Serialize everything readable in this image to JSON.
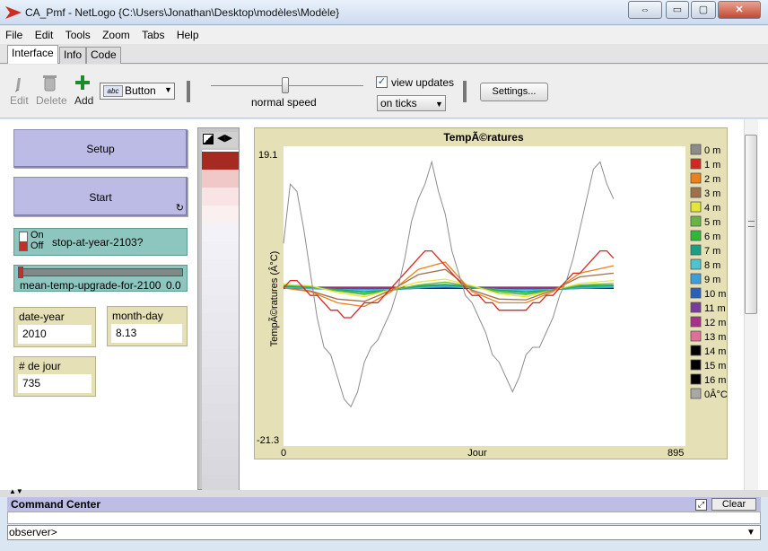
{
  "window": {
    "title": "CA_Pmf - NetLogo {C:\\Users\\Jonathan\\Desktop\\modèles\\Modèle}",
    "controls": {
      "restore": "⇔",
      "minimize": "▭",
      "maximize": "▢",
      "close": "✕"
    }
  },
  "menu": [
    "File",
    "Edit",
    "Tools",
    "Zoom",
    "Tabs",
    "Help"
  ],
  "tabs": [
    {
      "label": "Interface",
      "active": true
    },
    {
      "label": "Info",
      "active": false
    },
    {
      "label": "Code",
      "active": false
    }
  ],
  "toolbar": {
    "edit_label": "Edit",
    "delete_label": "Delete",
    "add_label": "Add",
    "widget_type": "Button",
    "widget_icon_text": "abc",
    "speed_label": "normal speed",
    "view_updates_label": "view updates",
    "view_updates_checked": true,
    "update_mode": "on ticks",
    "settings_label": "Settings..."
  },
  "widgets": {
    "setup_label": "Setup",
    "start_label": "Start",
    "switch": {
      "on_label": "On",
      "off_label": "Off",
      "label": "stop-at-year-2103?"
    },
    "slider": {
      "label": "mean-temp-upgrade-for-2100",
      "value": "0.0"
    },
    "monitors": [
      {
        "label": "date-year",
        "value": "2010"
      },
      {
        "label": "month-day",
        "value": "8.13"
      },
      {
        "label": "# de jour",
        "value": "735"
      }
    ]
  },
  "world": {
    "patch_colors": [
      "#ffffff",
      "#a52a22",
      "#f0c8c8",
      "#f8e4e4",
      "#fbf0f0",
      "#f2f2f8",
      "#f0f0f6",
      "#eeeef4",
      "#ececf2",
      "#eaeaf0",
      "#e8e8ee",
      "#e6e6ec",
      "#e4e4ea",
      "#e2e2e8",
      "#e0e0e6",
      "#dedee4",
      "#dcdce2",
      "#dadae0",
      "#d8d8de",
      "#d6d6dc",
      "#d4d4da"
    ]
  },
  "plot": {
    "title": "TempÃ©ratures",
    "ylabel": "TempÃ©ratures (Â°C)",
    "xlabel": "Jour",
    "ymax_label": "19.1",
    "ymin_label": "-21.3",
    "xmin_label": "0",
    "xmax_label": "895"
  },
  "chart_data": {
    "type": "line",
    "title": "TempÃ©ratures",
    "xlabel": "Jour",
    "ylabel": "TempÃ©ratures (Â°C)",
    "xlim": [
      0,
      895
    ],
    "ylim": [
      -21.3,
      19.1
    ],
    "legend_position": "right",
    "grid": false,
    "series": [
      {
        "name": "0 m",
        "color": "#8c8c8c",
        "x": [
          0,
          15,
          30,
          45,
          60,
          75,
          90,
          105,
          120,
          135,
          150,
          165,
          180,
          195,
          210,
          225,
          240,
          255,
          270,
          285,
          300,
          315,
          330,
          345,
          360,
          375,
          390,
          405,
          420,
          435,
          450,
          465,
          480,
          495,
          510,
          525,
          540,
          555,
          570,
          585,
          600,
          615,
          630,
          645,
          660,
          675,
          690,
          705,
          720,
          735
        ],
        "y": [
          6,
          14,
          13,
          8,
          2,
          -4,
          -8,
          -9,
          -12,
          -15,
          -16,
          -14,
          -10,
          -8,
          -7,
          -5,
          -3,
          0,
          4,
          9,
          12,
          14,
          17,
          13,
          10,
          5,
          2,
          -1,
          -2,
          -4,
          -6,
          -9,
          -10,
          -12,
          -14,
          -12,
          -9,
          -8,
          -8,
          -6,
          -4,
          -1,
          1,
          4,
          8,
          12,
          16,
          17,
          14,
          12
        ]
      },
      {
        "name": "1 m",
        "color": "#d7261e",
        "x": [
          0,
          15,
          30,
          45,
          60,
          75,
          90,
          105,
          120,
          135,
          150,
          165,
          180,
          195,
          210,
          225,
          240,
          255,
          270,
          285,
          300,
          315,
          330,
          345,
          360,
          375,
          390,
          405,
          420,
          435,
          450,
          465,
          480,
          495,
          510,
          525,
          540,
          555,
          570,
          585,
          600,
          615,
          630,
          645,
          660,
          675,
          690,
          705,
          720,
          735
        ],
        "y": [
          0,
          1,
          1,
          0,
          -1,
          -1,
          -2,
          -3,
          -3,
          -4,
          -4,
          -3,
          -2,
          -2,
          -2,
          -1,
          0,
          1,
          2,
          3,
          4,
          5,
          5,
          4,
          3,
          2,
          1,
          0,
          -1,
          -1,
          -2,
          -2,
          -3,
          -3,
          -3,
          -3,
          -3,
          -2,
          -2,
          -1,
          -1,
          0,
          1,
          2,
          2,
          3,
          4,
          5,
          5,
          4
        ]
      },
      {
        "name": "2 m",
        "color": "#ef7f1a",
        "x": [
          0,
          60,
          120,
          180,
          240,
          300,
          360,
          420,
          480,
          540,
          600,
          660,
          735
        ],
        "y": [
          0,
          -0.5,
          -2,
          -2.5,
          -0.5,
          2.5,
          3.5,
          -0.5,
          -2,
          -2,
          -0.5,
          2,
          3
        ]
      },
      {
        "name": "3 m",
        "color": "#a0704a",
        "x": [
          0,
          60,
          120,
          180,
          240,
          300,
          360,
          420,
          480,
          540,
          600,
          660,
          735
        ],
        "y": [
          0,
          -0.4,
          -1.5,
          -1.8,
          -0.3,
          1.8,
          2.5,
          -0.3,
          -1.5,
          -1.6,
          -0.3,
          1.5,
          2
        ]
      },
      {
        "name": "4 m",
        "color": "#e6e63a",
        "x": [
          0,
          60,
          120,
          180,
          240,
          300,
          360,
          420,
          480,
          540,
          600,
          660,
          735
        ],
        "y": [
          0.5,
          0.3,
          -0.6,
          -1.2,
          -0.2,
          0.8,
          1.2,
          0.3,
          -0.8,
          -1.2,
          -0.3,
          0.6,
          1
        ]
      },
      {
        "name": "5 m",
        "color": "#6ab446",
        "x": [
          0,
          60,
          120,
          180,
          240,
          300,
          360,
          420,
          480,
          540,
          600,
          660,
          735
        ],
        "y": [
          0.4,
          0.2,
          -0.4,
          -0.9,
          -0.3,
          0.4,
          0.8,
          0.2,
          -0.6,
          -0.9,
          -0.3,
          0.4,
          0.6
        ]
      },
      {
        "name": "6 m",
        "color": "#2db83a",
        "x": [
          0,
          60,
          120,
          180,
          240,
          300,
          360,
          420,
          480,
          540,
          600,
          660,
          735
        ],
        "y": [
          0.3,
          0.2,
          -0.3,
          -0.7,
          -0.3,
          0.3,
          0.5,
          0.2,
          -0.4,
          -0.7,
          -0.3,
          0.3,
          0.4
        ]
      },
      {
        "name": "7 m",
        "color": "#16a084",
        "x": [
          0,
          60,
          120,
          180,
          240,
          300,
          360,
          420,
          480,
          540,
          600,
          660,
          735
        ],
        "y": [
          0.2,
          0.1,
          -0.2,
          -0.5,
          -0.3,
          0.2,
          0.4,
          0.1,
          -0.3,
          -0.5,
          -0.3,
          0.2,
          0.3
        ]
      },
      {
        "name": "8 m",
        "color": "#4cc5d2",
        "x": [
          0,
          60,
          120,
          180,
          240,
          300,
          360,
          420,
          480,
          540,
          600,
          660,
          735
        ],
        "y": [
          0.1,
          0,
          -0.2,
          -0.4,
          -0.2,
          0.1,
          0.3,
          0,
          -0.2,
          -0.4,
          -0.2,
          0.1,
          0.2
        ]
      },
      {
        "name": "9 m",
        "color": "#3a9fdc",
        "x": [
          0,
          120,
          240,
          360,
          480,
          600,
          735
        ],
        "y": [
          0,
          -0.2,
          -0.2,
          0.2,
          -0.2,
          -0.2,
          0.1
        ]
      },
      {
        "name": "10 m",
        "color": "#2a5fbf",
        "x": [
          0,
          120,
          240,
          360,
          480,
          600,
          735
        ],
        "y": [
          0,
          -0.1,
          -0.2,
          0.1,
          -0.1,
          -0.2,
          0.1
        ]
      },
      {
        "name": "11 m",
        "color": "#7a3c9a",
        "x": [
          0,
          120,
          240,
          360,
          480,
          600,
          735
        ],
        "y": [
          0,
          -0.1,
          -0.1,
          0.1,
          -0.1,
          -0.1,
          0
        ]
      },
      {
        "name": "12 m",
        "color": "#a8308a",
        "x": [
          0,
          735
        ],
        "y": [
          0,
          0
        ]
      },
      {
        "name": "13 m",
        "color": "#e0709a",
        "x": [
          0,
          735
        ],
        "y": [
          0,
          0
        ]
      },
      {
        "name": "14 m",
        "color": "#000000",
        "x": [
          0,
          735
        ],
        "y": [
          0,
          0
        ]
      },
      {
        "name": "15 m",
        "color": "#000000",
        "x": [
          0,
          735
        ],
        "y": [
          0,
          0
        ]
      },
      {
        "name": "16 m",
        "color": "#000000",
        "x": [
          0,
          735
        ],
        "y": [
          0,
          0
        ]
      },
      {
        "name": "0Â°C",
        "color": "#a8a8a8",
        "x": [
          0,
          735
        ],
        "y": [
          0,
          0
        ]
      }
    ]
  },
  "command_center": {
    "title": "Command Center",
    "clear_label": "Clear",
    "prompt": "observer>",
    "input_value": ""
  }
}
